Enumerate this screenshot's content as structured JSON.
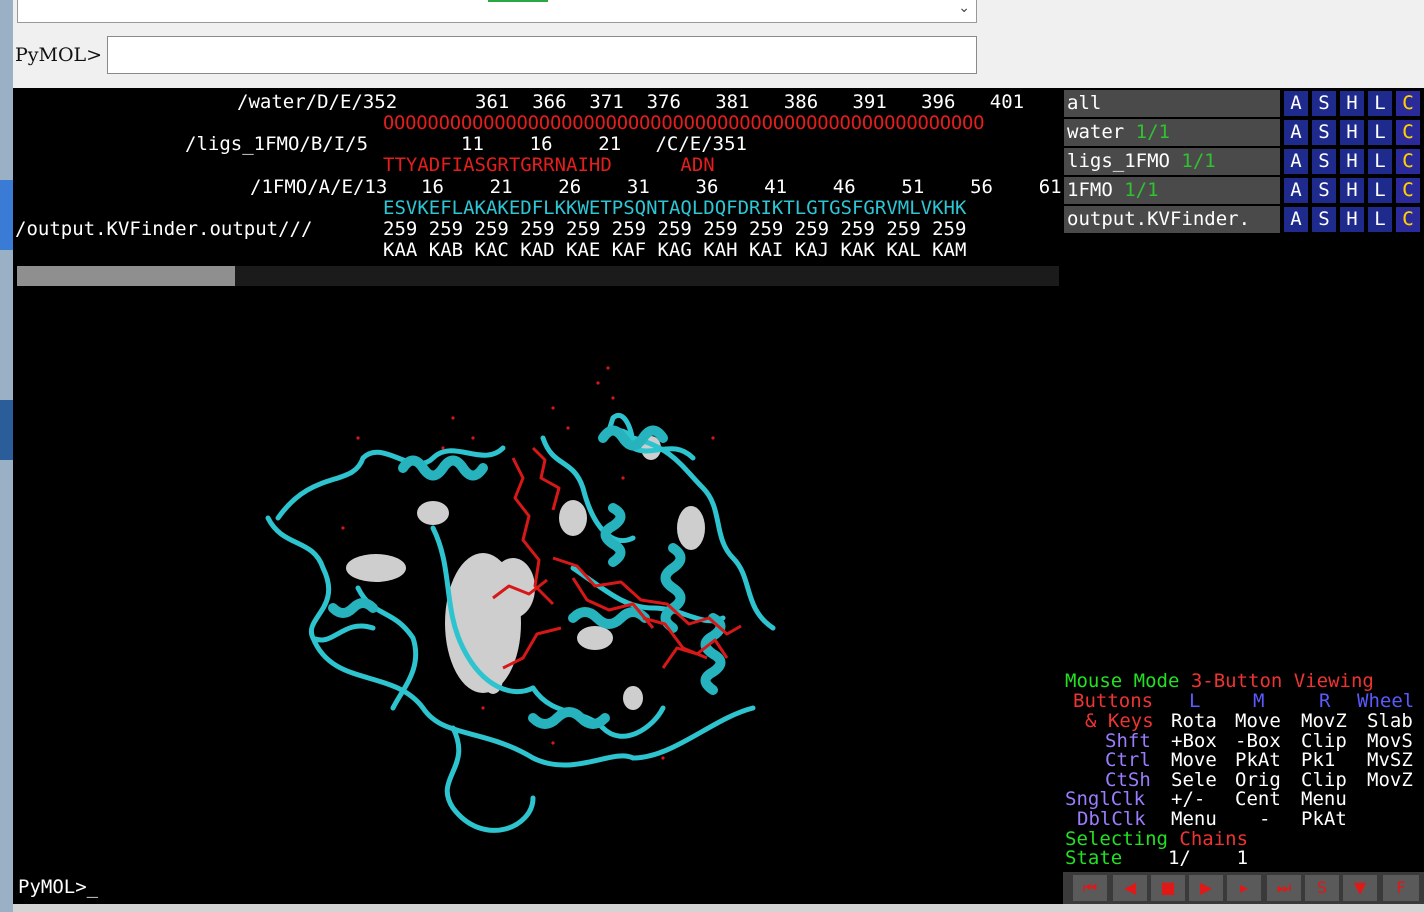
{
  "command_bar": {
    "prompt_label": "PyMOL>",
    "input_value": ""
  },
  "sequence_viewer": {
    "lines": [
      {
        "label": "/water/D/E/352",
        "numbers": "361  366  371  376   381   386   391   396   401"
      },
      {
        "residues_red": "OOOOOOOOOOOOOOOOOOOOOOOOOOOOOOOOOOOOOOOOOOOOOOOOOOOOOO"
      },
      {
        "label": "/ligs_1FMO/B/I/5",
        "numbers": "11    16    21   /C/E/351"
      },
      {
        "residues_red": "TTYADFIASGRTGRRNAIHD      ADN"
      },
      {
        "label": "/1FMO/A/E/13",
        "numbers": "16    21    26    31    36    41    46    51    56    61"
      },
      {
        "residues_cyan": "ESVKEFLAKAKEDFLKKWETPSQNTAQLDQFDRIKTLGTGSFGRVMLVKHK"
      },
      {
        "label": "/output.KVFinder.output///",
        "numbers": "259 259 259 259 259 259 259 259 259 259 259 259 259"
      },
      {
        "numbers": "KAA KAB KAC KAD KAE KAF KAG KAH KAI KAJ KAK KAL KAM"
      }
    ]
  },
  "viewer_prompt": "PyMOL>_",
  "objects": [
    {
      "name": "all",
      "frac": ""
    },
    {
      "name": "water",
      "frac": "1/1"
    },
    {
      "name": "ligs_1FMO",
      "frac": "1/1"
    },
    {
      "name": "1FMO",
      "frac": "1/1"
    },
    {
      "name": "output.KVFinder.",
      "frac": ""
    }
  ],
  "object_buttons": [
    "A",
    "S",
    "H",
    "L",
    "C"
  ],
  "mouse_mode": {
    "title_green": "Mouse Mode",
    "title_rest": "3-Button Viewing",
    "buttons_label": "Buttons",
    "buttons": [
      "L",
      "M",
      "R",
      "Wheel"
    ],
    "rows": [
      {
        "key": "& Keys",
        "vals": [
          "Rota",
          "Move",
          "MovZ",
          "Slab"
        ]
      },
      {
        "key": "Shft",
        "vals": [
          "+Box",
          "-Box",
          "Clip",
          "MovS"
        ]
      },
      {
        "key": "Ctrl",
        "vals": [
          "Move",
          "PkAt",
          "Pk1",
          "MvSZ"
        ]
      },
      {
        "key": "CtSh",
        "vals": [
          "Sele",
          "Orig",
          "Clip",
          "MovZ"
        ]
      },
      {
        "key": "SnglClk",
        "vals": [
          "+/-",
          "Cent",
          "Menu",
          ""
        ]
      },
      {
        "key": "DblClk",
        "vals": [
          "Menu",
          "-",
          "PkAt",
          ""
        ]
      }
    ],
    "selecting_label": "Selecting",
    "selecting_value": "Chains",
    "state_label": "State",
    "state_value": "1/    1"
  },
  "transport_buttons": [
    "first-frame",
    "prev-frame",
    "stop",
    "play",
    "next-frame",
    "last-frame",
    "scene",
    "toggle",
    "full-screen"
  ],
  "colors": {
    "cartoon": "#2ec4cf",
    "ligand": "#d81818",
    "cavity": "#e8e8e8",
    "background": "#000000"
  }
}
